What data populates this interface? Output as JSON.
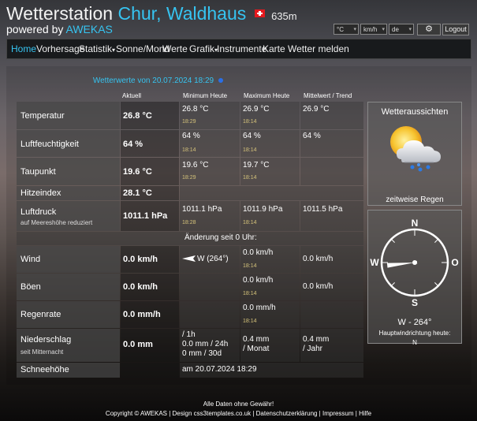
{
  "header": {
    "title_main": "Wetterstation",
    "title_city": "Chur, Waldhaus",
    "altitude": "635m",
    "powered_by": "powered by",
    "brand": "AWEKAS"
  },
  "controls": {
    "temp_unit": "°C",
    "wind_unit": "km/h",
    "language": "de",
    "logout": "Logout"
  },
  "nav": {
    "items": [
      "Home",
      "Vorhersage",
      "Statistik",
      "Sonne/Mond",
      "Werte",
      "Grafik",
      "Instrumente",
      "Karte",
      "Wetter melden"
    ]
  },
  "main": {
    "heading": "Wetterwerte von  20.07.2024 18:29",
    "columns": [
      "Aktuell",
      "Minimum Heute",
      "Maximum Heute",
      "Mittelwert / Trend"
    ],
    "rows": {
      "temperatur": {
        "label": "Temperatur",
        "aktuell": "26.8 °C",
        "min": "26.8 °C",
        "min_time": "18:29",
        "max": "26.9 °C",
        "max_time": "18:14",
        "mittel": "26.9 °C"
      },
      "feuchte": {
        "label": "Luftfeuchtigkeit",
        "aktuell": "64 %",
        "min": "64 %",
        "min_time": "18:14",
        "max": "64 %",
        "max_time": "18:14",
        "mittel": "64 %"
      },
      "taupunkt": {
        "label": "Taupunkt",
        "aktuell": "19.6 °C",
        "min": "19.6 °C",
        "min_time": "18:29",
        "max": "19.7 °C",
        "max_time": "18:14"
      },
      "hitze": {
        "label": "Hitzeindex",
        "aktuell": "28.1 °C"
      },
      "druck": {
        "label": "Luftdruck",
        "sub": "auf Meereshöhe reduziert",
        "aktuell": "1011.1 hPa",
        "min": "1011.1 hPa",
        "min_time": "18:28",
        "max": "1011.9 hPa",
        "max_time": "18:14",
        "mittel": "1011.5 hPa"
      },
      "aenderung": "Änderung seit 0 Uhr:",
      "wind": {
        "label": "Wind",
        "aktuell": "0.0 km/h",
        "dir": "W (264°)",
        "max": "0.0 km/h",
        "max_time": "18:14",
        "mittel": "0.0 km/h"
      },
      "boeen": {
        "label": "Böen",
        "aktuell": "0.0 km/h",
        "max": "0.0 km/h",
        "max_time": "18:14",
        "mittel": "0.0 km/h"
      },
      "regenrate": {
        "label": "Regenrate",
        "aktuell": "0.0 mm/h",
        "max": "0.0 mm/h",
        "max_time": "18:14"
      },
      "niederschlag": {
        "label": "Niederschlag",
        "sub": "seit Mitternacht",
        "aktuell": "0.0 mm",
        "l1": "/ 1h",
        "l2": "0.0 mm / 24h",
        "l3": "0 mm / 30d",
        "max1": "0.4 mm",
        "max2": "/ Monat",
        "m1": "0.4 mm",
        "m2": "/ Jahr"
      },
      "schnee": {
        "label": "Schneehöhe",
        "value": "am 20.07.2024 18:29"
      }
    }
  },
  "forecast": {
    "title": "Wetteraussichten",
    "text": "zeitweise Regen"
  },
  "compass": {
    "n": "N",
    "s": "S",
    "w": "W",
    "o": "O",
    "reading": "W -  264°",
    "caption": "Hauptwindrichtung heute:",
    "today": "N",
    "direction_deg": 264
  },
  "footer": {
    "line1": "Alle Daten ohne Gewähr!",
    "line2": "Copyright © AWEKAS | Design css3templates.co.uk | Datenschutzerklärung | Impressum | Hilfe"
  }
}
